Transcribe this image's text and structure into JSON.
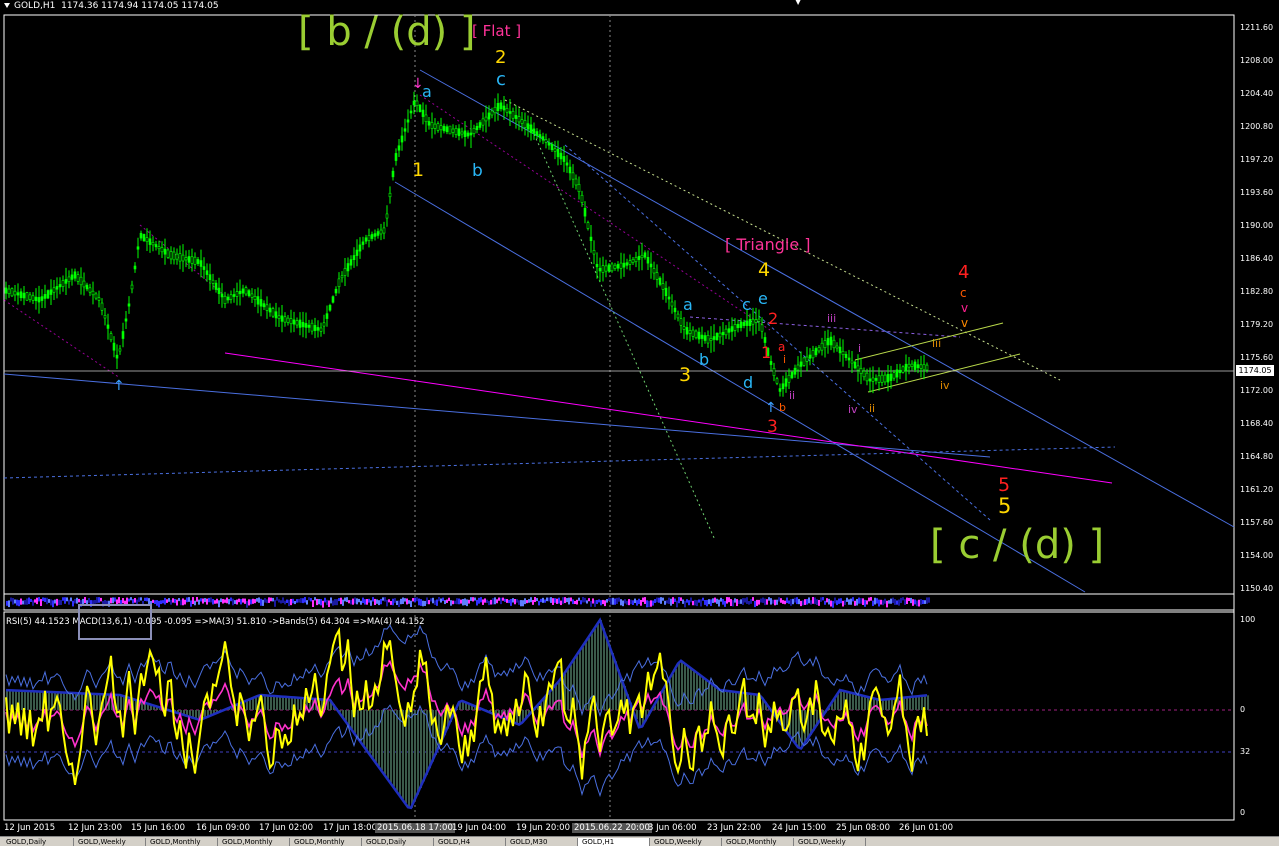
{
  "chart": {
    "title": "GOLD,H1",
    "ohlc": "1174.36 1174.94 1174.05 1174.05",
    "current_price": "1174.05",
    "price_axis": [
      "1211.60",
      "1208.00",
      "1204.40",
      "1200.80",
      "1197.20",
      "1193.60",
      "1190.00",
      "1186.40",
      "1182.80",
      "1179.20",
      "1175.60",
      "1172.00",
      "1168.40",
      "1164.80",
      "1161.20",
      "1157.60",
      "1154.00",
      "1150.40"
    ],
    "time_axis": [
      "12 Jun 2015",
      "12 Jun 23:00",
      "15 Jun 16:00",
      "16 Jun 09:00",
      "17 Jun 02:00",
      "17 Jun 18:00",
      "2015.06.18 17:00",
      "19 Jun 04:00",
      "19 Jun 20:00",
      "2015.06.22 20:00",
      "3 Jun 06:00",
      "23 Jun 22:00",
      "24 Jun 15:00",
      "25 Jun 08:00",
      "26 Jun 01:00"
    ],
    "highlighted_times": [
      "2015.06.18 17:00",
      "2015.06.22 20:00"
    ],
    "colors": {
      "bull": "#00ff00",
      "bear": "#00ff00",
      "background": "#000000",
      "channel": "#4169e1",
      "magenta": "#ff00ff"
    }
  },
  "annotations": {
    "b_d": "[ b / (d) ]",
    "flat": "[ Flat ]",
    "wave2": "2",
    "c_top": "c",
    "a_top": "a",
    "one": "1",
    "b_mid": "b",
    "triangle": "[ Triangle ]",
    "four_y": "4",
    "a_tri": "a",
    "b_tri": "b",
    "c_tri": "c",
    "d_tri": "d",
    "e_tri": "e",
    "three_y": "3",
    "red2": "2",
    "red1": "1",
    "red_a": "a",
    "red_b": "b",
    "red_i": "i",
    "red3": "3",
    "pink_ii": "ii",
    "pink_iii": "iii",
    "pink_i": "i",
    "pink_iv": "iv",
    "pink_ii2": "ii",
    "orange_iii": "iii",
    "orange_iv": "iv",
    "red4": "4",
    "org_c": "c",
    "org_v1": "v",
    "org_v2": "v",
    "red5": "5",
    "yel5": "5",
    "c_d": "[ c / (d) ]"
  },
  "indicator": {
    "header": "RSI(5) 44.1523   MACD(13,6,1) -0.095 -0.095   =>MA(3) 51.810   ->Bands(5) 64.304   =>MA(4) 44.152",
    "levels": [
      "100",
      "0",
      "32",
      "0"
    ]
  },
  "tabs": [
    "GOLD,Daily",
    "GOLD,Weekly",
    "GOLD,Monthly",
    "GOLD,Monthly",
    "GOLD,Monthly",
    "GOLD,Daily",
    "GOLD,H4",
    "GOLD,M30",
    "GOLD,H1",
    "GOLD,Weekly",
    "GOLD,Monthly",
    "GOLD,Weekly"
  ],
  "active_tab": 8
}
